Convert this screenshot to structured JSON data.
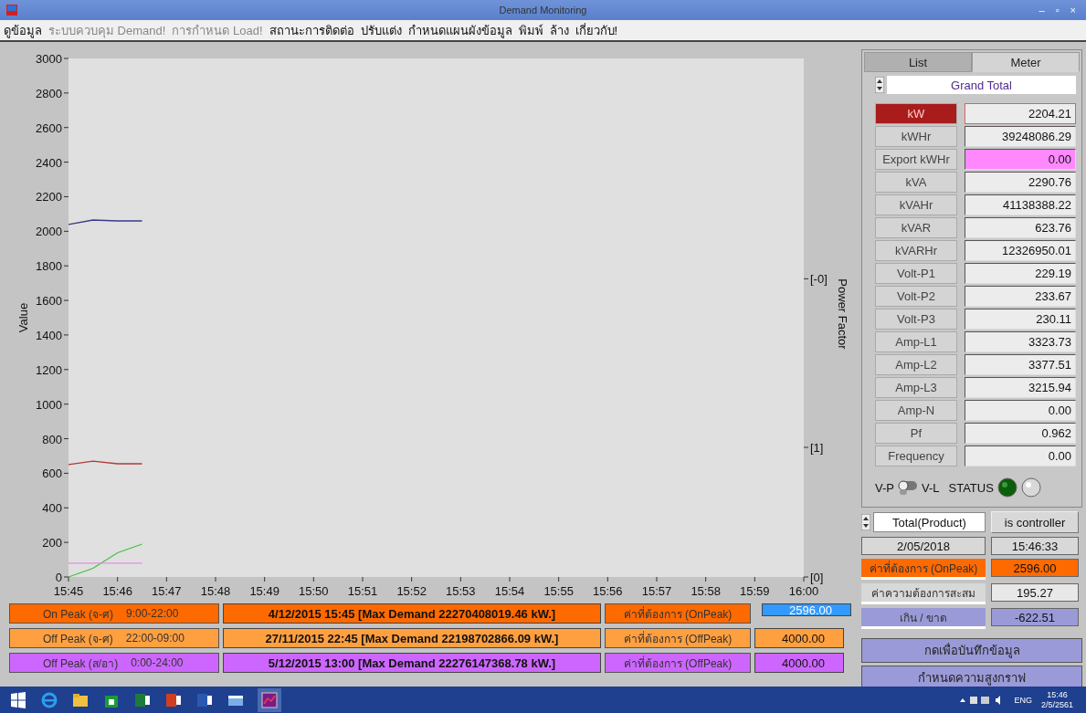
{
  "window": {
    "title": "Demand Monitoring",
    "controls": [
      "–",
      "▫",
      "×"
    ]
  },
  "menu": [
    {
      "label": "ดูข้อมูล",
      "disabled": false
    },
    {
      "label": "ระบบควบคุม Demand!",
      "disabled": true
    },
    {
      "label": "การกำหนด Load!",
      "disabled": true
    },
    {
      "label": "สถานะการติดต่อ",
      "disabled": false
    },
    {
      "label": "ปรับแต่ง",
      "disabled": false
    },
    {
      "label": "กำหนดแผนผังข้อมูล",
      "disabled": false
    },
    {
      "label": "พิมพ์",
      "disabled": false
    },
    {
      "label": "ล้าง",
      "disabled": false
    },
    {
      "label": "เกี่ยวกับ!",
      "disabled": false
    }
  ],
  "chart": {
    "right_axis": {
      "label": "Power Factor",
      "ticks": [
        "[-0]",
        "[1]",
        "[0]"
      ]
    },
    "chart_data": {
      "type": "line",
      "ylabel": "Value",
      "ylim": [
        0,
        3000
      ],
      "categories": [
        "15:45",
        null,
        "15:46",
        null,
        "15:47",
        null,
        "15:48",
        null,
        "15:49",
        null,
        "15:50",
        null,
        "15:51",
        null,
        "15:52",
        null,
        "15:53",
        null,
        "15:54",
        null,
        "15:55",
        null,
        "15:56",
        null,
        "15:57",
        null,
        "15:58",
        null,
        "15:59",
        null,
        "16:00"
      ],
      "yticks": [
        0,
        200,
        400,
        600,
        800,
        1000,
        1200,
        1400,
        1600,
        1800,
        2000,
        2200,
        2400,
        2600,
        2800,
        3000
      ],
      "series": [
        {
          "color": "#3a3a8c",
          "values": [
            2040,
            2065,
            2060,
            2060,
            null,
            null,
            null,
            null,
            null,
            null,
            null,
            null,
            null,
            null,
            null,
            null,
            null,
            null,
            null,
            null,
            null,
            null,
            null,
            null,
            null,
            null,
            null,
            null,
            null,
            null,
            null
          ]
        },
        {
          "color": "#b03a3a",
          "values": [
            650,
            670,
            655,
            655,
            null,
            null,
            null,
            null,
            null,
            null,
            null,
            null,
            null,
            null,
            null,
            null,
            null,
            null,
            null,
            null,
            null,
            null,
            null,
            null,
            null,
            null,
            null,
            null,
            null,
            null,
            null
          ]
        },
        {
          "color": "#44c044",
          "values": [
            0,
            50,
            140,
            190,
            null,
            null,
            null,
            null,
            null,
            null,
            null,
            null,
            null,
            null,
            null,
            null,
            null,
            null,
            null,
            null,
            null,
            null,
            null,
            null,
            null,
            null,
            null,
            null,
            null,
            null,
            null
          ]
        },
        {
          "color": "#e090e0",
          "values": [
            80,
            80,
            80,
            80,
            null,
            null,
            null,
            null,
            null,
            null,
            null,
            null,
            null,
            null,
            null,
            null,
            null,
            null,
            null,
            null,
            null,
            null,
            null,
            null,
            null,
            null,
            null,
            null,
            null,
            null,
            null
          ]
        }
      ]
    }
  },
  "peaks": [
    {
      "name": "On Peak  (จ-ศ)",
      "hours": "9:00-22:00",
      "color": "#ff6a00",
      "record": "4/12/2015  15:45 [Max Demand 22270408019.46 kW.]",
      "target_label": "ค่าที่ต้องการ (OnPeak)",
      "target": "2596.00",
      "selected": true
    },
    {
      "name": "Off Peak (จ-ศ)",
      "hours": "22:00-09:00",
      "color": "#ffa040",
      "record": "27/11/2015  22:45 [Max Demand 22198702866.09 kW.]",
      "target_label": "ค่าที่ต้องการ (OffPeak)",
      "target": "4000.00",
      "selected": false
    },
    {
      "name": "Off Peak (ส/อา)",
      "hours": "0:00-24:00",
      "color": "#cc66ff",
      "record": "5/12/2015  13:00 [Max Demand 22276147368.78 kW.]",
      "target_label": "ค่าที่ต้องการ (OffPeak)",
      "target": "4000.00",
      "selected": false
    }
  ],
  "tabs": [
    {
      "label": "List",
      "selected": false
    },
    {
      "label": "Meter",
      "selected": true
    }
  ],
  "meter_select": "Grand Total",
  "readings": [
    {
      "name": "kW",
      "value": "2204.21",
      "selected": true,
      "color": "#ececec"
    },
    {
      "name": "kWHr",
      "value": "39248086.29",
      "selected": false,
      "color": "#ececec"
    },
    {
      "name": "Export kWHr",
      "value": "0.00",
      "selected": false,
      "color": "#ff88ff"
    },
    {
      "name": "kVA",
      "value": "2290.76",
      "selected": false,
      "color": "#ececec"
    },
    {
      "name": "kVAHr",
      "value": "41138388.22",
      "selected": false,
      "color": "#ececec"
    },
    {
      "name": "kVAR",
      "value": "623.76",
      "selected": false,
      "color": "#ececec"
    },
    {
      "name": "kVARHr",
      "value": "12326950.01",
      "selected": false,
      "color": "#ececec"
    },
    {
      "name": "Volt-P1",
      "value": "229.19",
      "selected": false,
      "color": "#ececec"
    },
    {
      "name": "Volt-P2",
      "value": "233.67",
      "selected": false,
      "color": "#ececec"
    },
    {
      "name": "Volt-P3",
      "value": "230.11",
      "selected": false,
      "color": "#ececec"
    },
    {
      "name": "Amp-L1",
      "value": "3323.73",
      "selected": false,
      "color": "#ececec"
    },
    {
      "name": "Amp-L2",
      "value": "3377.51",
      "selected": false,
      "color": "#ececec"
    },
    {
      "name": "Amp-L3",
      "value": "3215.94",
      "selected": false,
      "color": "#ececec"
    },
    {
      "name": "Amp-N",
      "value": "0.00",
      "selected": false,
      "color": "#ececec"
    },
    {
      "name": "Pf",
      "value": "0.962",
      "selected": false,
      "color": "#ececec"
    },
    {
      "name": "Frequency",
      "value": "0.00",
      "selected": false,
      "color": "#ececec"
    }
  ],
  "switch": {
    "left_label": "V-P",
    "right_label": "V-L",
    "on": false
  },
  "status": {
    "label": "STATUS",
    "lights": [
      {
        "on": true
      },
      {
        "on": false
      }
    ]
  },
  "controller": {
    "select": "Total(Product)",
    "role": "is controller",
    "date": "2/05/2018",
    "time": "15:46:33",
    "rows": [
      {
        "label": "ค่าที่ต้องการ (OnPeak)",
        "value": "2596.00",
        "color": "#ff6a00"
      },
      {
        "label": "ค่าความต้องการสะสม",
        "value": "195.27",
        "color": "#d8d8d8"
      },
      {
        "label": "เกิน / ขาด",
        "value": "-622.51",
        "color": "#9a9ad8"
      }
    ],
    "buttons": [
      "กดเพื่อบันทึกข้อมูล",
      "กำหนดความสูงกราฟ"
    ]
  },
  "taskbar": {
    "language": "ENG",
    "time": "15:46",
    "date": "2/5/2561"
  }
}
